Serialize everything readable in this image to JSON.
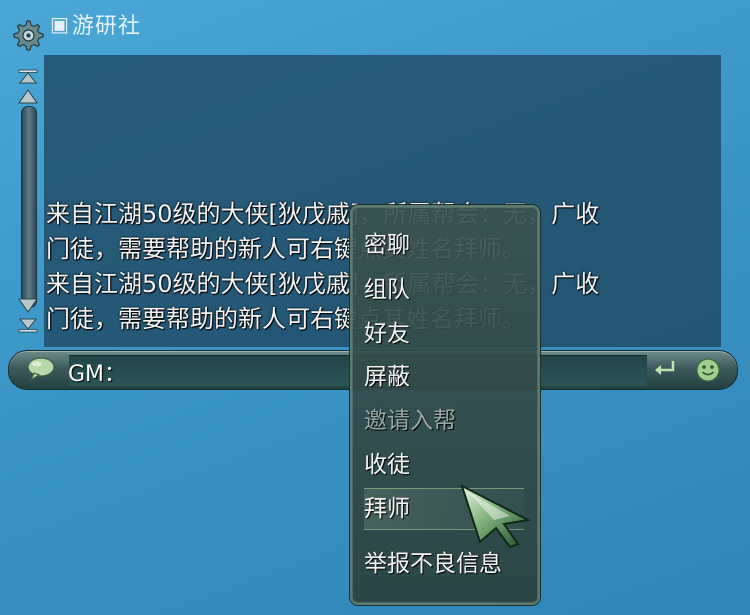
{
  "watermark": {
    "text": "游研社"
  },
  "chat": {
    "lines": [
      "来自江湖50级的大侠[狄戊戚]，所属帮会：无，广收",
      "门徒，需要帮助的新人可右键点其姓名拜师。",
      "来自江湖50级的大侠[狄戊戚]，所属帮会：无，广收",
      "门徒，需要帮助的新人可右键点其姓名拜师。"
    ]
  },
  "input_bar": {
    "channel": "GM："
  },
  "context_menu": {
    "items": [
      {
        "label": "密聊",
        "enabled": true
      },
      {
        "label": "组队",
        "enabled": true
      },
      {
        "label": "好友",
        "enabled": true
      },
      {
        "label": "屏蔽",
        "enabled": true
      },
      {
        "label": "邀请入帮",
        "enabled": false
      },
      {
        "label": "收徒",
        "enabled": true
      },
      {
        "label": "拜师",
        "enabled": true,
        "hovered": true
      },
      {
        "label": "举报不良信息",
        "enabled": true
      }
    ]
  },
  "colors": {
    "background": "#3b95c6",
    "chat_panel": "#1e465f",
    "menu_bg": "#3a5250",
    "accent_green": "#8fd08a"
  },
  "icons": {
    "settings": "gear-icon",
    "scroll_top": "scroll-top-icon",
    "scroll_up": "scroll-up-icon",
    "scroll_down": "scroll-down-icon",
    "scroll_bottom": "scroll-bottom-icon",
    "chat_bubble": "chat-bubble-icon",
    "enter": "enter-icon",
    "emoji": "emoji-icon",
    "cursor": "cursor-arrow-icon"
  }
}
